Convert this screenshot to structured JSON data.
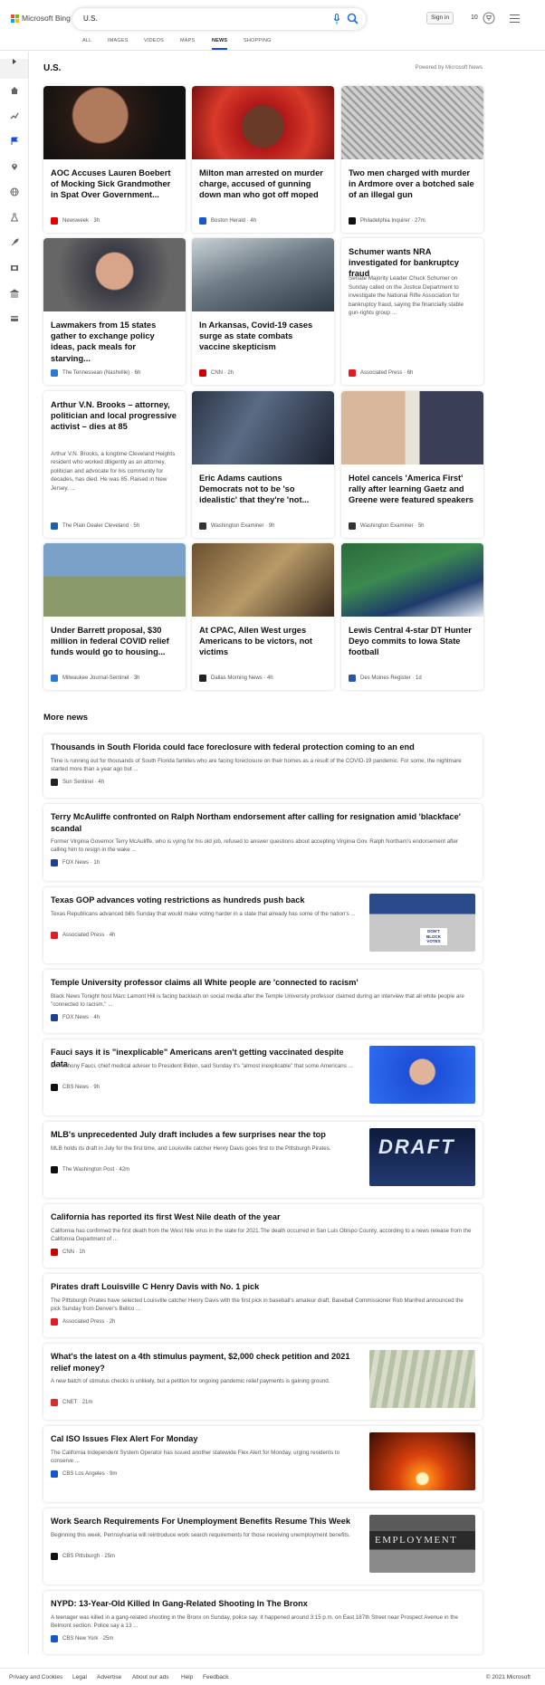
{
  "brand": {
    "name": "Microsoft Bing",
    "colors": [
      "#f25022",
      "#7fba00",
      "#00a4ef",
      "#ffb900"
    ]
  },
  "search": {
    "value": "U.S."
  },
  "header": {
    "signin": "Sign in",
    "rewards_count": "10"
  },
  "tabs": [
    "ALL",
    "IMAGES",
    "VIDEOS",
    "MAPS",
    "NEWS",
    "SHOPPING"
  ],
  "active_tab": "NEWS",
  "section": {
    "title": "U.S.",
    "powered_by": "Powered by Microsoft News"
  },
  "cards": [
    {
      "title": "AOC Accuses Lauren Boebert of Mocking Sick Grandmother in Spat Over Government...",
      "source": "Newsweek",
      "time": "3h",
      "src_color": "#e00000"
    },
    {
      "title": "Milton man arrested on murder charge, accused of gunning down man who got off moped",
      "source": "Boston Herald",
      "time": "4h",
      "src_color": "#1a55c9"
    },
    {
      "title": "Two men charged with murder in Ardmore over a botched sale of an illegal gun",
      "source": "Philadelphia Inquirer",
      "time": "27m",
      "src_color": "#111111"
    },
    {
      "title": "Lawmakers from 15 states gather to exchange policy ideas, pack meals for starving...",
      "source": "The Tennessean (Nashville)",
      "time": "6h",
      "src_color": "#2a7ad1"
    },
    {
      "title": "In Arkansas, Covid-19 cases surge as state combats vaccine skepticism",
      "source": "CNN",
      "time": "2h",
      "src_color": "#cc0000"
    },
    {
      "title": "Schumer wants NRA investigated for bankruptcy fraud",
      "snippet": "Senate Majority Leader Chuck Schumer on Sunday called on the Justice Department to investigate the National Rifle Association for bankruptcy fraud, saying the financially stable gun-rights group ...",
      "source": "Associated Press",
      "time": "6h",
      "src_color": "#e01b22"
    },
    {
      "title": "Arthur V.N. Brooks – attorney, politician and local progressive activist – dies at 85",
      "snippet": "Arthur V.N. Brooks, a longtime Cleveland Heights resident who worked diligently as an attorney, politician and advocate for his community for decades, has died. He was 85. Raised in New Jersey, ...",
      "source": "The Plain Dealer Cleveland",
      "time": "5h",
      "src_color": "#1f5fa8"
    },
    {
      "title": "Eric Adams cautions Democrats not to be 'so idealistic' that they're 'not...",
      "source": "Washington Examiner",
      "time": "9h",
      "src_color": "#333333"
    },
    {
      "title": "Hotel cancels 'America First' rally after learning Gaetz and Greene were featured speakers",
      "source": "Washington Examiner",
      "time": "5h",
      "src_color": "#333333"
    },
    {
      "title": "Under Barrett proposal, $30 million in federal COVID relief funds would go to housing...",
      "source": "Milwaukee Journal-Sentinel",
      "time": "3h",
      "src_color": "#2a7ad1"
    },
    {
      "title": "At CPAC, Allen West urges Americans to be victors, not victims",
      "source": "Dallas Morning News",
      "time": "4h",
      "src_color": "#222222"
    },
    {
      "title": "Lewis Central 4-star DT Hunter Deyo commits to Iowa State football",
      "source": "Des Moines Register",
      "time": "1d",
      "src_color": "#2a55a8"
    }
  ],
  "more_news": {
    "title": "More news",
    "items": [
      {
        "title": "Thousands in South Florida could face foreclosure with federal protection coming to an end",
        "snippet": "Time is running out for thousands of South Florida families who are facing foreclosure on their homes as a result of the COVID-19 pandemic. For some, the nightmare started more than a year ago but ...",
        "source": "Sun Sentinel",
        "time": "4h",
        "src_color": "#222222"
      },
      {
        "title": "Terry McAuliffe confronted on Ralph Northam endorsement after calling for resignation amid 'blackface' scandal",
        "snippet": "Former Virginia Governor Terry McAuliffe, who is vying for his old job, refused to answer questions about accepting Virginia Gov. Ralph Northam's endorsement after calling him to resign in the wake ...",
        "source": "FOX News",
        "time": "1h",
        "src_color": "#1f3f8f"
      },
      {
        "title": "Texas GOP advances voting restrictions as hundreds push back",
        "snippet": "Texas Republicans advanced bills Sunday that would make voting harder in a state that already has some of the nation's ...",
        "source": "Associated Press",
        "time": "4h",
        "src_color": "#e01b22"
      },
      {
        "title": "Temple University professor claims all White people are 'connected to racism'",
        "snippet": "Black News Tonight host Marc Lamont Hill is facing backlash on social media after the Temple University professor claimed during an interview that all white people are \"connected to racism.\" ...",
        "source": "FOX News",
        "time": "4h",
        "src_color": "#1f3f8f"
      },
      {
        "title": "Fauci says it is \"inexplicable\" Americans aren't getting vaccinated despite data",
        "snippet": "Dr. Anthony Fauci, chief medical adviser to President Biden, said Sunday it's \"almost inexplicable\" that some Americans ...",
        "source": "CBS News",
        "time": "9h",
        "src_color": "#111111"
      },
      {
        "title": "MLB's unprecedented July draft includes a few surprises near the top",
        "snippet": "MLB holds its draft in July for the first time, and Louisville catcher Henry Davis goes first to the Pittsburgh Pirates.",
        "source": "The Washington Post",
        "time": "42m",
        "src_color": "#111111"
      },
      {
        "title": "California has reported its first West Nile death of the year",
        "snippet": "California has confirmed the first death from the West Nile virus in the state for 2021.The death occurred in San Luis Obispo County, according to a news release from the California Department of ...",
        "source": "CNN",
        "time": "1h",
        "src_color": "#cc0000"
      },
      {
        "title": "Pirates draft Louisville C Henry Davis with No. 1 pick",
        "snippet": "The Pittsburgh Pirates have selected Louisville catcher Henry Davis with the first pick in baseball's amateur draft. Baseball Commissioner Rob Manfred announced the pick Sunday from Denver's Bellco ...",
        "source": "Associated Press",
        "time": "2h",
        "src_color": "#e01b22"
      },
      {
        "title": "What's the latest on a 4th stimulus payment, $2,000 check petition and 2021 relief money?",
        "snippet": "A new batch of stimulus checks is unlikely, but a petition for ongoing pandemic relief payments is gaining ground.",
        "source": "CNET",
        "time": "21m",
        "src_color": "#d32f2f"
      },
      {
        "title": "Cal ISO Issues Flex Alert For Monday",
        "snippet": "The California Independent System Operator has issued another statewide Flex Alert for Monday, urging residents to conserve ...",
        "source": "CBS Los Angeles",
        "time": "9m",
        "src_color": "#1a55c9"
      },
      {
        "title": "Work Search Requirements For Unemployment Benefits Resume This Week",
        "snippet": "Beginning this week, Pennsylvania will reintroduce work search requirements for those receiving unemployment benefits.",
        "source": "CBS Pittsburgh",
        "time": "25m",
        "src_color": "#111111"
      },
      {
        "title": "NYPD: 13-Year-Old Killed In Gang-Related Shooting In The Bronx",
        "snippet": "A teenager was killed in a gang-related shooting in the Bronx on Sunday, police say. It happened around 3:15 p.m. on East 187th Street near Prospect Avenue in the Belmont section. Police say a 13 ...",
        "source": "CBS New York",
        "time": "25m",
        "src_color": "#1a55c9"
      }
    ]
  },
  "thumb_text": {
    "texas": "DON'T BLOCK VOTES",
    "draft": "DRAFT",
    "employment": "EMPLOYMENT"
  },
  "footer": {
    "links": [
      "Privacy and Cookies",
      "Legal",
      "Advertise",
      "About our ads",
      "Help",
      "Feedback"
    ],
    "copyright": "© 2021 Microsoft"
  },
  "icons": [
    "menu-expand-icon",
    "home-icon",
    "trending-icon",
    "flag-icon",
    "location-icon",
    "globe-icon",
    "science-icon",
    "rocket-icon",
    "movie-icon",
    "bank-icon",
    "card-icon"
  ]
}
